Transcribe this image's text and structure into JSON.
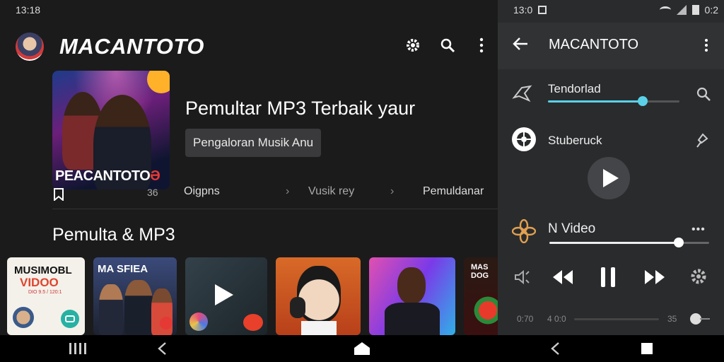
{
  "left_status": {
    "time": "13:18"
  },
  "app": {
    "title": "MACANTOTO"
  },
  "hero": {
    "caption_main": "PEACANTOTO",
    "caption_mark": "Ə",
    "heading": "Pemultar MP3 Terbaik yaur",
    "button_label": "Pengaloran Musik Anu",
    "bookmark_count": "36"
  },
  "breadcrumbs": [
    "Oigpns",
    "Vusik rey",
    "Pemuldanar"
  ],
  "section": {
    "title": "Pemulta & MP3"
  },
  "tiles": [
    {
      "title": "MUSIMOBL",
      "subtitle": "VIDOO",
      "small": "DIO 9.5 / 120:1",
      "bg": "#f4f1ea"
    },
    {
      "title": "MA SFIEA",
      "bg": "#2a2f45"
    },
    {
      "title": "",
      "bg": "#23313a"
    },
    {
      "title": "",
      "bg": "#c8541c"
    },
    {
      "title": "",
      "bg": "#8a34c7"
    },
    {
      "title": "MAS DOG",
      "bg": "#2a1a14"
    }
  ],
  "right_status": {
    "time": "13:0",
    "right": "0:2"
  },
  "panel": {
    "title": "MACANTOTO",
    "row1_label": "Tendorlad",
    "row1_progress": 0.72,
    "row2_label": "Stuberuck",
    "row3_label": "N Video",
    "row3_progress": 0.88,
    "bottom_left": "0:70",
    "bottom_mid": "4 0:0",
    "bottom_right": "35"
  },
  "colors": {
    "accent": "#5bd1e8",
    "play_red": "#e53935",
    "nav": "#000000"
  }
}
